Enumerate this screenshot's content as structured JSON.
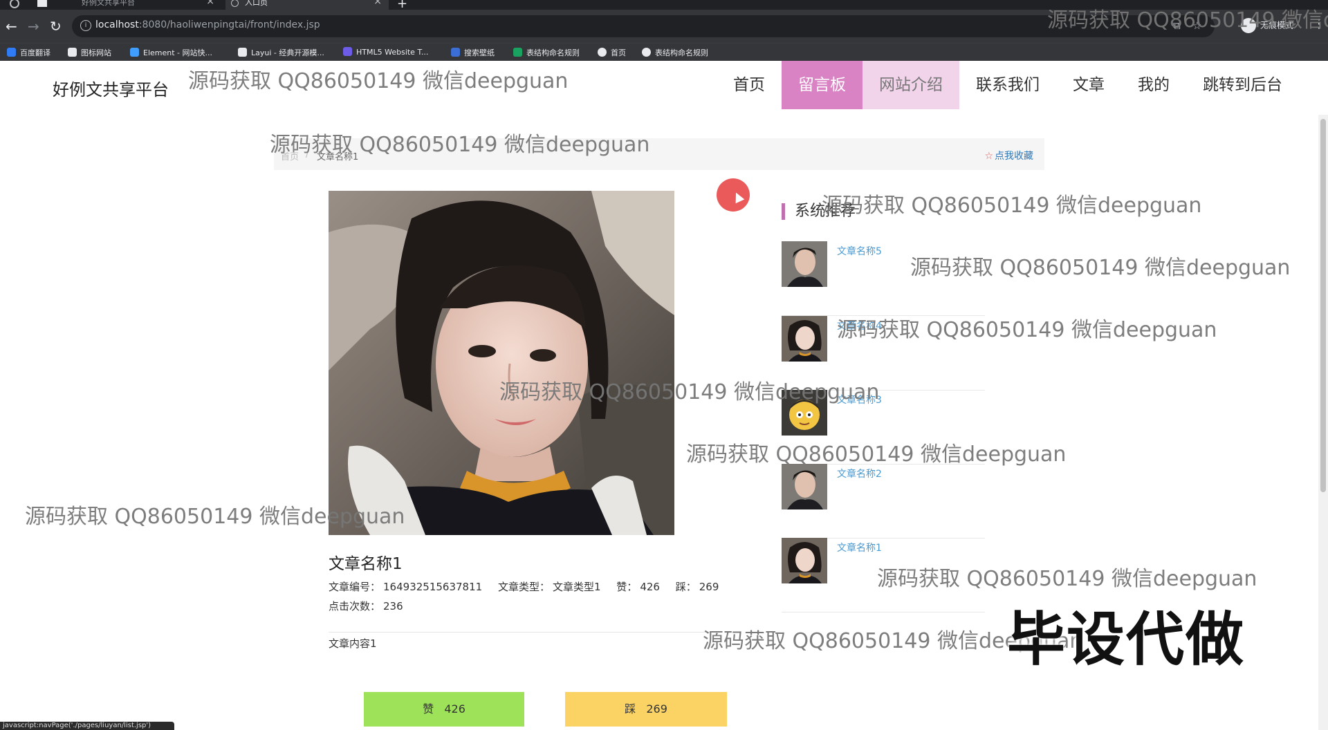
{
  "browser": {
    "tabs": [
      {
        "title": "好例文共享平台",
        "active": false
      },
      {
        "title": "入口页",
        "active": true
      }
    ],
    "url_host": "localhost",
    "url_path": ":8080/haoliwenpingtai/front/index.jsp",
    "incognito_label": "无痕模式",
    "bookmarks": [
      {
        "label": "百度翻译",
        "color": "#2f7cf6"
      },
      {
        "label": "图标网站",
        "color": "#e8eaed"
      },
      {
        "label": "Element - 网站快...",
        "color": "#409eff"
      },
      {
        "label": "Layui - 经典开源模...",
        "color": "#e8eaed"
      },
      {
        "label": "HTML5 Website T...",
        "color": "#6c5ce7"
      },
      {
        "label": "搜索壁纸",
        "color": "#3b6fd6"
      },
      {
        "label": "表结构命名规则",
        "color": "#1aa260"
      },
      {
        "label": "首页",
        "color": "#e8eaed"
      },
      {
        "label": "表结构命名规则",
        "color": "#e8eaed"
      }
    ]
  },
  "site": {
    "title": "好例文共享平台",
    "nav": [
      "首页",
      "留言板",
      "网站介绍",
      "联系我们",
      "文章",
      "我的",
      "跳转到后台"
    ]
  },
  "breadcrumb": {
    "home": "首页",
    "sep": "/",
    "current": "文章名称1",
    "favorite": "点我收藏"
  },
  "article": {
    "title": "文章名称1",
    "meta_row1": [
      {
        "label": "文章编号：",
        "value": "164932515637811"
      },
      {
        "label": "文章类型：",
        "value": "文章类型1"
      },
      {
        "label": "赞：",
        "value": "426"
      },
      {
        "label": "踩：",
        "value": "269"
      }
    ],
    "meta_row2": [
      {
        "label": "点击次数：",
        "value": "236"
      }
    ],
    "content": "文章内容1",
    "like_label": "赞",
    "like_count": "426",
    "dislike_label": "踩",
    "dislike_count": "269"
  },
  "sidebar": {
    "title": "系统推荐",
    "items": [
      {
        "name": "文章名称5",
        "thumb": "man"
      },
      {
        "name": "文章名称4",
        "thumb": "woman"
      },
      {
        "name": "文章名称3",
        "thumb": "cartoon"
      },
      {
        "name": "文章名称2",
        "thumb": "man"
      },
      {
        "name": "文章名称1",
        "thumb": "woman"
      }
    ]
  },
  "status_bar": "javascript:navPage('./pages/liuyan/list.jsp')",
  "watermarks": {
    "text": "源码获取 QQ86050149 微信deepguan",
    "big": "毕设代做"
  },
  "colors": {
    "accent": "#d982c4",
    "like": "#9ee25a",
    "dislike": "#fbd365",
    "link": "#4a9ad0"
  }
}
